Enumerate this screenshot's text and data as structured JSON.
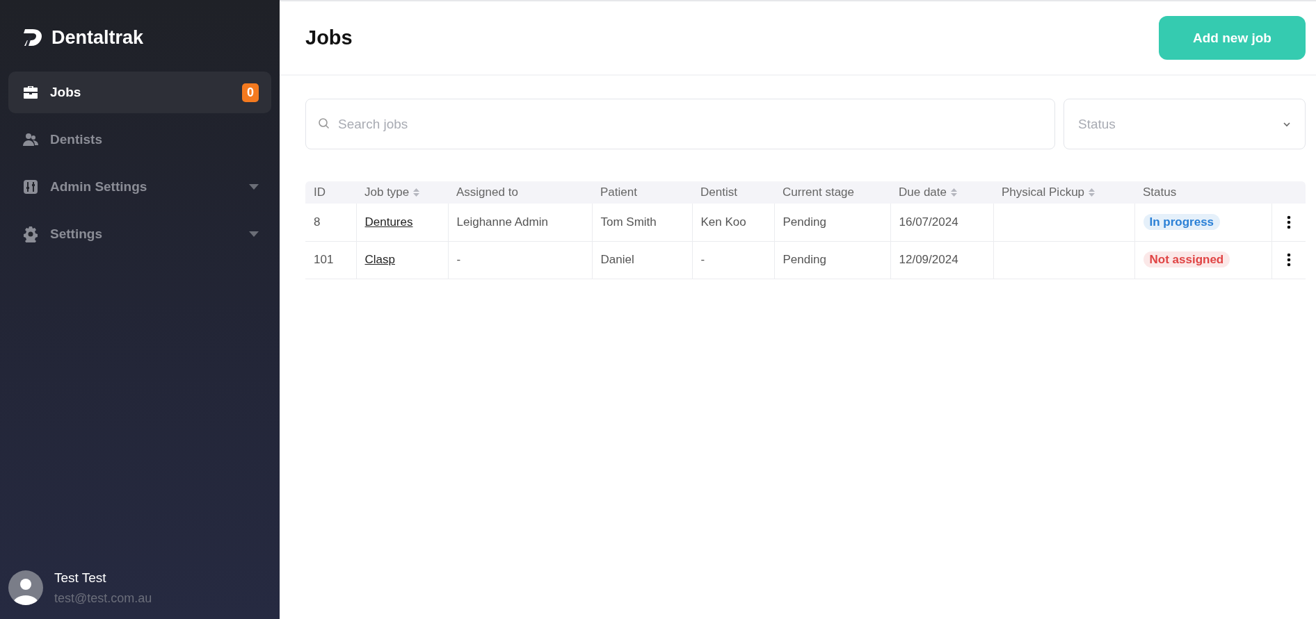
{
  "sidebar": {
    "brand": "Dentaltrak",
    "items": [
      {
        "label": "Jobs",
        "kind": "briefcase",
        "selected": true,
        "badge": "0",
        "expandable": false
      },
      {
        "label": "Dentists",
        "kind": "users",
        "selected": false,
        "expandable": false
      },
      {
        "label": "Admin Settings",
        "kind": "sliders",
        "selected": false,
        "expandable": true
      },
      {
        "label": "Settings",
        "kind": "gear",
        "selected": false,
        "expandable": true
      }
    ],
    "user": {
      "name": "Test Test",
      "email": "test@test.com.au"
    }
  },
  "header": {
    "title": "Jobs",
    "button": "Add new job"
  },
  "filters": {
    "search": {
      "placeholder": "Search jobs"
    },
    "status": {
      "placeholder": "Status"
    }
  },
  "table": {
    "columns": [
      {
        "label": "ID",
        "sortable": false
      },
      {
        "label": "Job type",
        "sortable": true
      },
      {
        "label": "Assigned to",
        "sortable": false
      },
      {
        "label": "Patient",
        "sortable": false
      },
      {
        "label": "Dentist",
        "sortable": false
      },
      {
        "label": "Current stage",
        "sortable": false
      },
      {
        "label": "Due date",
        "sortable": true
      },
      {
        "label": "Physical Pickup",
        "sortable": true
      },
      {
        "label": "Status",
        "sortable": false
      }
    ],
    "rows": [
      {
        "id": "8",
        "job_type": "Dentures",
        "assigned_to": "Leighanne Admin",
        "patient": "Tom Smith",
        "dentist": "Ken Koo",
        "stage": "Pending",
        "due": "16/07/2024",
        "status": {
          "label": "In progress",
          "color": "#2b80d6"
        }
      },
      {
        "id": "101",
        "job_type": "Clasp",
        "assigned_to": "-",
        "patient": "Daniel",
        "dentist": "-",
        "stage": "Pending",
        "due": "12/09/2024",
        "status": {
          "label": "Not assigned",
          "color": "#e04444"
        }
      }
    ]
  }
}
